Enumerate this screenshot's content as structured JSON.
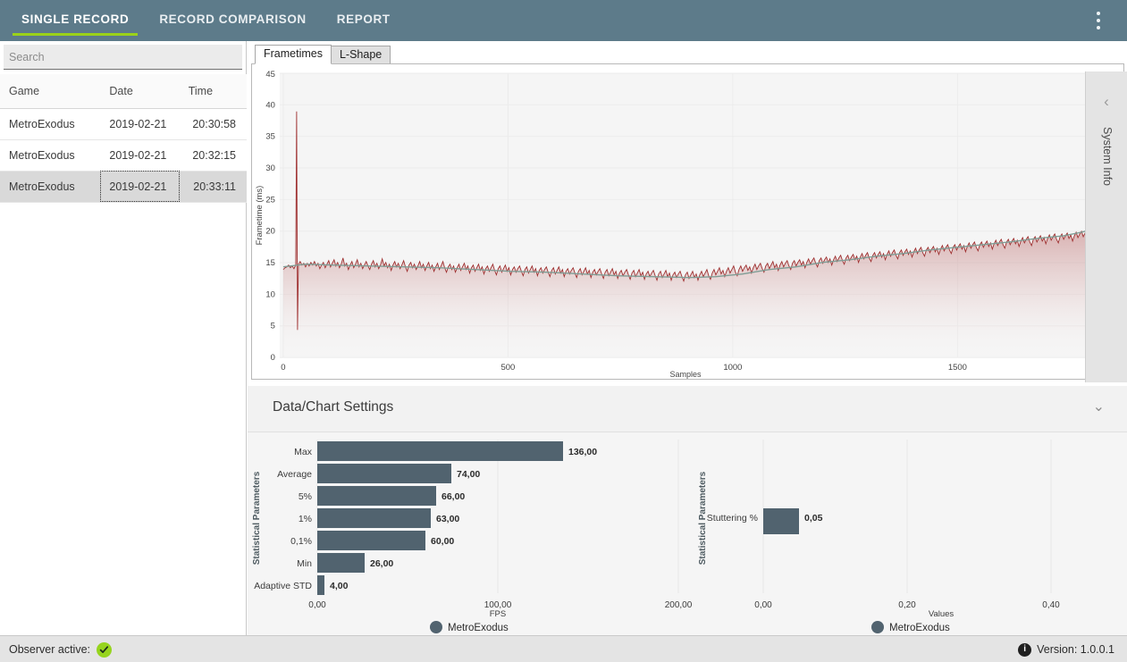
{
  "header": {
    "tabs": [
      {
        "label": "SINGLE RECORD",
        "active": true
      },
      {
        "label": "RECORD COMPARISON",
        "active": false
      },
      {
        "label": "REPORT",
        "active": false
      }
    ],
    "accent_color": "#9bd219",
    "bg_color": "#5d7b8a",
    "overflow_menu_icon": "more-vertical-icon"
  },
  "sidebar": {
    "search": {
      "placeholder": "Search",
      "value": ""
    },
    "table": {
      "columns": [
        "Game",
        "Date",
        "Time"
      ],
      "rows": [
        {
          "game": "MetroExodus",
          "date": "2019-02-21",
          "time": "20:30:58",
          "selected": false
        },
        {
          "game": "MetroExodus",
          "date": "2019-02-21",
          "time": "20:32:15",
          "selected": false
        },
        {
          "game": "MetroExodus",
          "date": "2019-02-21",
          "time": "20:33:11",
          "selected": true
        }
      ]
    }
  },
  "chart_panel": {
    "tabs": [
      {
        "label": "Frametimes",
        "active": true
      },
      {
        "label": "L-Shape",
        "active": false
      }
    ]
  },
  "system_info_panel": {
    "label": "System Info",
    "collapse_icon": "chevron-left-icon"
  },
  "settings": {
    "title": "Data/Chart Settings",
    "expand_icon": "chevron-down-icon"
  },
  "status_bar": {
    "observer_label": "Observer active:",
    "observer_state_icon": "check-circle-icon",
    "observer_state_color": "#96d41e",
    "version_label": "Version: 1.0.0.1",
    "version_icon": "info-icon"
  },
  "chart_data": [
    {
      "id": "frametimes",
      "type": "line",
      "title": "",
      "xlabel": "Samples",
      "ylabel": "Frametime (ms)",
      "xlim": [
        0,
        1800
      ],
      "ylim": [
        0,
        45
      ],
      "xticks": [
        0,
        500,
        1000,
        1500
      ],
      "yticks": [
        0,
        5,
        10,
        15,
        20,
        25,
        30,
        35,
        40,
        45
      ],
      "grid": true,
      "series": [
        {
          "name": "frametime",
          "color": "#9e2f2f",
          "fill": "gradient red fading to white",
          "description": "Noisy per-frame frametime trace around 13-16 ms with a single 39 ms spike near sample 20 and a dip to 6.5 ms",
          "x": [
            0,
            20,
            25,
            40,
            80,
            150,
            250,
            350,
            450,
            550,
            650,
            750,
            850,
            950,
            1050,
            1150,
            1250,
            1350,
            1450,
            1550,
            1650,
            1720,
            1800
          ],
          "y": [
            13.2,
            39.0,
            6.5,
            14.6,
            14.2,
            13.8,
            13.6,
            13.4,
            13.5,
            13.3,
            13.0,
            12.8,
            13.1,
            13.6,
            14.0,
            14.2,
            14.3,
            14.5,
            14.6,
            14.0,
            15.0,
            16.4,
            16.6
          ]
        },
        {
          "name": "moving-average",
          "color": "#7f9d95",
          "description": "Smoothed average line following the frametime trend",
          "x": [
            0,
            100,
            300,
            500,
            700,
            900,
            1100,
            1300,
            1500,
            1650,
            1800
          ],
          "y": [
            14.4,
            14.0,
            13.6,
            13.3,
            12.9,
            13.4,
            14.1,
            14.4,
            14.4,
            15.2,
            16.5
          ]
        }
      ]
    },
    {
      "id": "statistical-parameters-fps",
      "type": "bar",
      "orientation": "horizontal",
      "ylabel": "Statistical Parameters",
      "xlabel": "FPS",
      "xlim": [
        0,
        240
      ],
      "xticks": [
        0,
        100,
        200
      ],
      "xticklabels": [
        "0,00",
        "100,00",
        "200,00"
      ],
      "grid": true,
      "legend": [
        "MetroExodus"
      ],
      "legend_position": "bottom",
      "bar_color": "#51636f",
      "categories": [
        "Max",
        "Average",
        "5%",
        "1%",
        "0,1%",
        "Min",
        "Adaptive STD"
      ],
      "values": [
        136,
        74,
        66,
        63,
        60,
        26,
        4
      ],
      "value_labels": [
        "136,00",
        "74,00",
        "66,00",
        "63,00",
        "60,00",
        "26,00",
        "4,00"
      ]
    },
    {
      "id": "statistical-parameters-stuttering",
      "type": "bar",
      "orientation": "horizontal",
      "ylabel": "Statistical Parameters",
      "xlabel": "Values",
      "xlim": [
        0,
        0.48
      ],
      "xticks": [
        0,
        0.2,
        0.4
      ],
      "xticklabels": [
        "0,00",
        "0,20",
        "0,40"
      ],
      "grid": true,
      "legend": [
        "MetroExodus"
      ],
      "legend_position": "bottom",
      "bar_color": "#51636f",
      "categories": [
        "Stuttering %"
      ],
      "values": [
        0.05
      ],
      "value_labels": [
        "0,05"
      ]
    }
  ]
}
